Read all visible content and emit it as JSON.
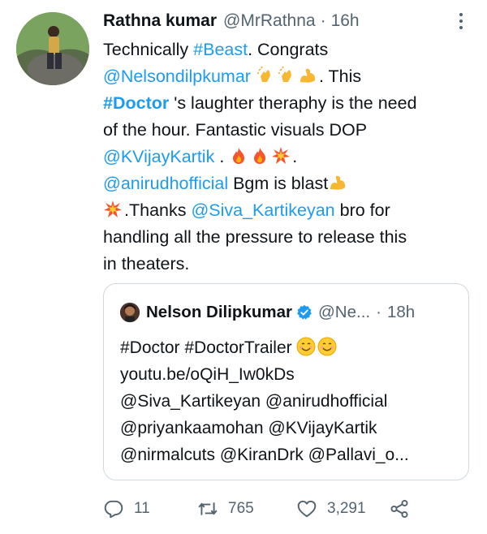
{
  "tweet": {
    "author_name": "Rathna kumar",
    "author_handle": "@MrRathna",
    "time_sep": "·",
    "time": "16h",
    "body": {
      "l1_a": "Technically ",
      "l1_tag": "#Beast",
      "l1_b": ". Congrats",
      "l2_mention": "@Nelsondilpkumar",
      "l2_b": ". This",
      "l3_tag": "#Doctor",
      "l3_b": " 's laughter theraphy is the need",
      "l4": "of the hour. Fantastic visuals DOP",
      "l5_mention": "@KVijayKartik",
      "l5_b": " . ",
      "l5_c": ".",
      "l6_mention": "@anirudhofficial",
      "l6_b": " Bgm is blast",
      "l7_a": ".Thanks ",
      "l7_mention": "@Siva_Kartikeyan",
      "l7_b": " bro for",
      "l8": "handling all the pressure to release this",
      "l9": "in theaters."
    }
  },
  "quoted": {
    "name": "Nelson Dilipkumar",
    "handle": "@Ne...",
    "time_sep": "·",
    "time": "18h",
    "lines": [
      "#Doctor #DoctorTrailer",
      "youtu.be/oQiH_Iw0kDs",
      "@Siva_Kartikeyan @anirudhofficial",
      "@priyankaamohan @KVijayKartik",
      "@nirmalcuts @KiranDrk @Pallavi_o..."
    ]
  },
  "actions": {
    "reply_count": "11",
    "retweet_count": "765",
    "like_count": "3,291"
  },
  "icons": {
    "reply": "reply-icon",
    "retweet": "retweet-icon",
    "like": "heart-icon",
    "share": "share-icon",
    "verified": "verified-badge-icon",
    "more": "more-options-icon"
  },
  "colors": {
    "link": "#1d9bf0",
    "secondary": "#536471",
    "border": "#cfd9de",
    "verified": "#1d9bf0"
  }
}
